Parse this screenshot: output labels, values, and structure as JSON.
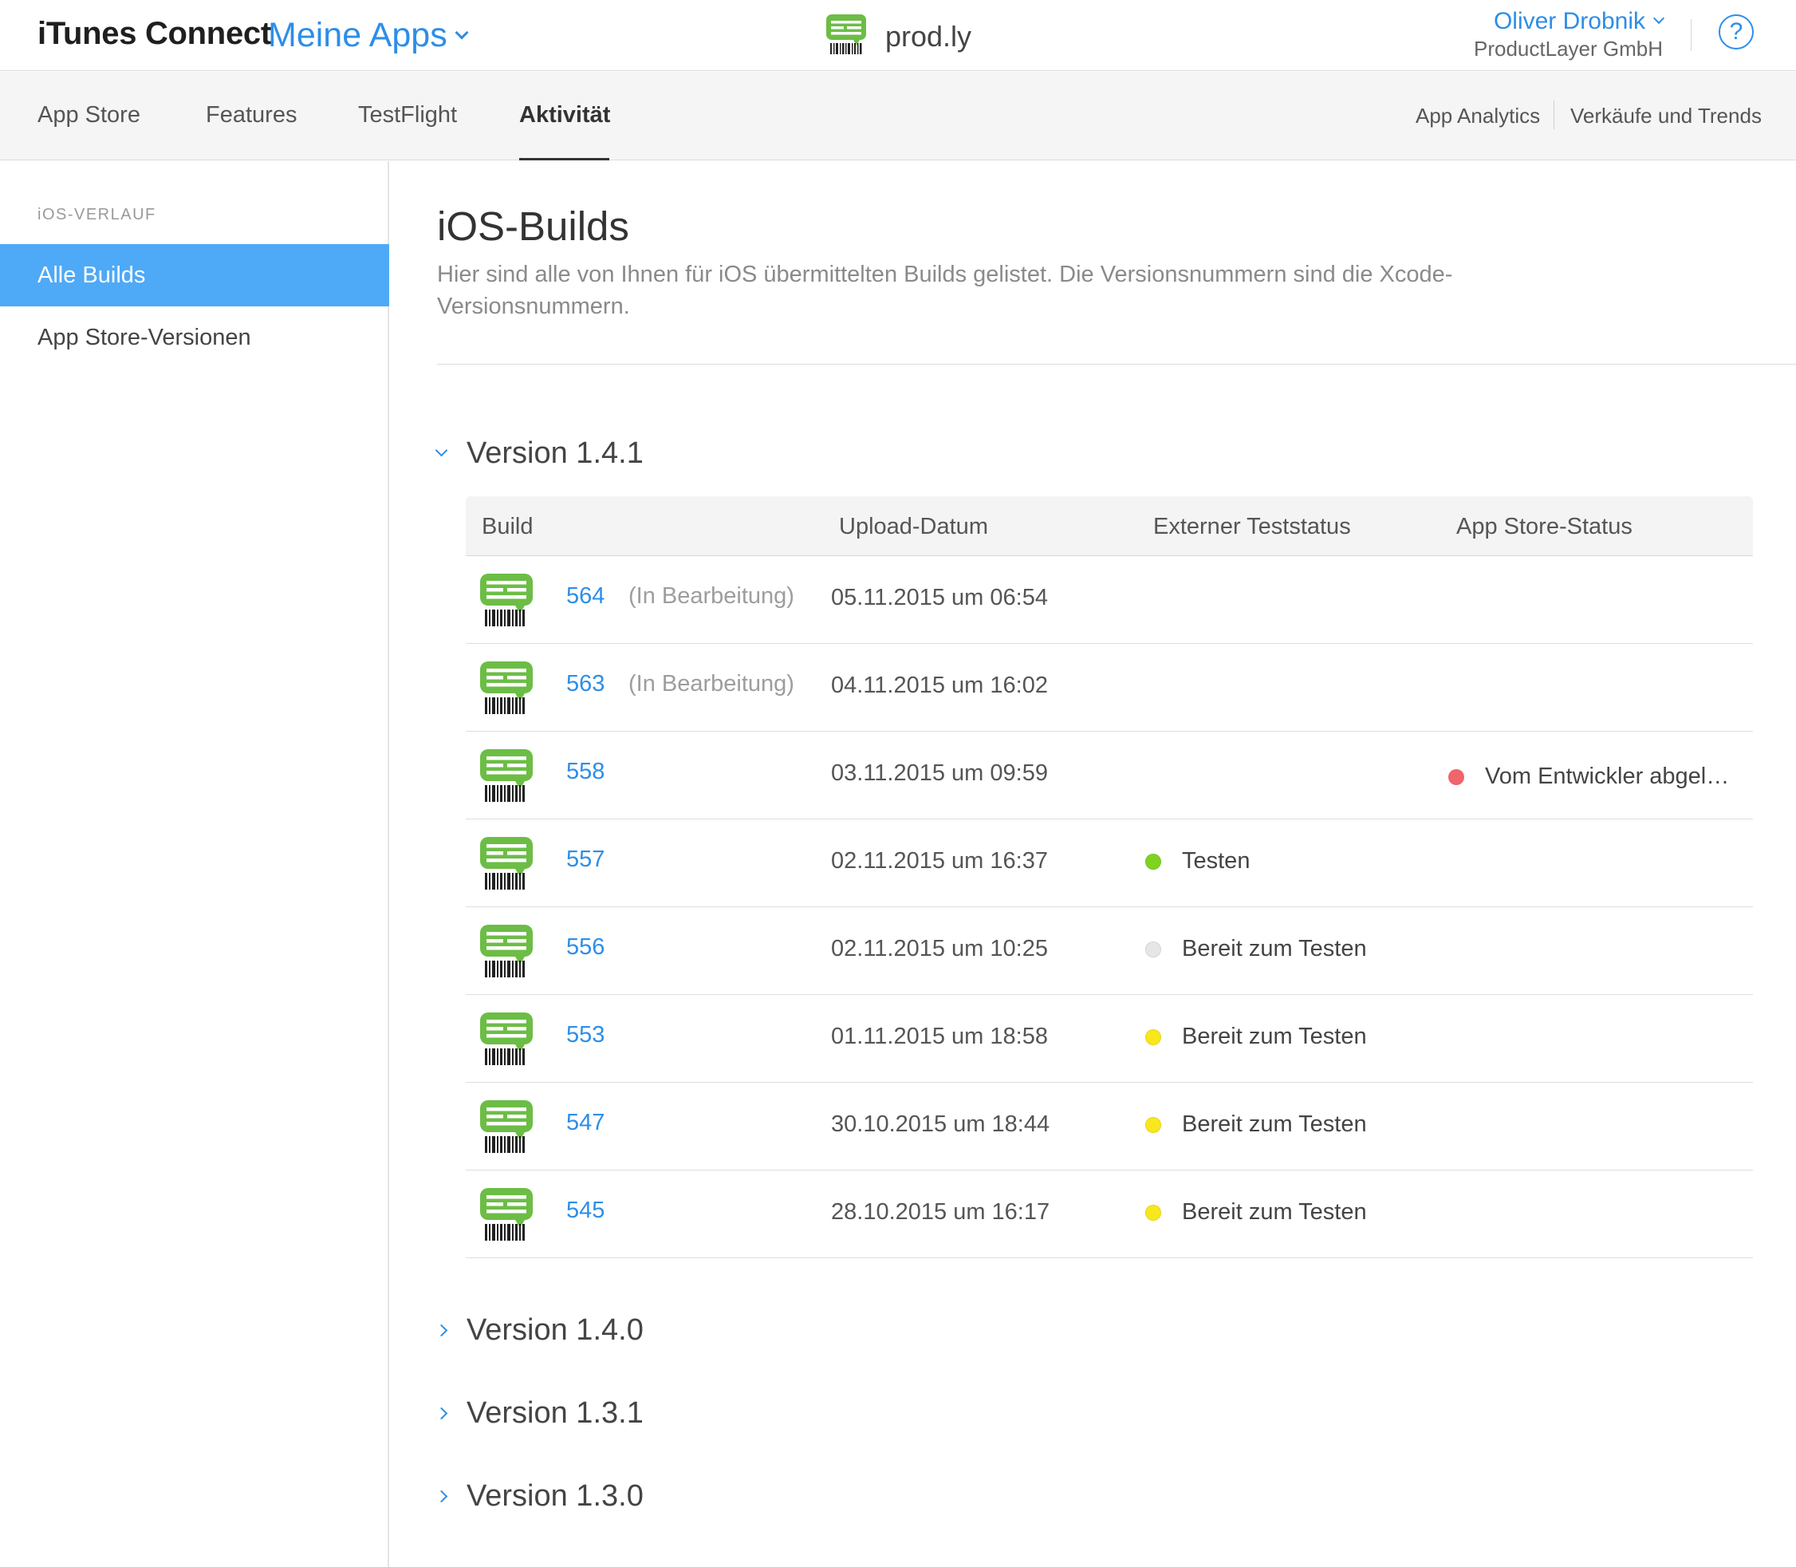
{
  "header": {
    "brand": "iTunes Connect",
    "my_apps": "Meine Apps",
    "app_name": "prod.ly",
    "user_name": "Oliver Drobnik",
    "org_name": "ProductLayer GmbH",
    "help": "?"
  },
  "subnav": {
    "tabs": [
      {
        "label": "App Store"
      },
      {
        "label": "Features"
      },
      {
        "label": "TestFlight"
      },
      {
        "label": "Aktivität"
      }
    ],
    "right_links": [
      {
        "label": "App Analytics"
      },
      {
        "label": "Verkäufe und Trends"
      }
    ]
  },
  "sidebar": {
    "heading": "iOS-VERLAUF",
    "items": [
      {
        "label": "Alle Builds"
      },
      {
        "label": "App Store-Versionen"
      }
    ]
  },
  "main": {
    "title": "iOS-Builds",
    "description": "Hier sind alle von Ihnen für iOS übermittelten Builds gelistet. Die Versionsnummern sind die Xcode-Versionsnummern.",
    "versions": [
      {
        "label": "Version 1.4.1"
      },
      {
        "label": "Version 1.4.0"
      },
      {
        "label": "Version 1.3.1"
      },
      {
        "label": "Version 1.3.0"
      }
    ],
    "table": {
      "columns": [
        "Build",
        "Upload-Datum",
        "Externer Teststatus",
        "App Store-Status"
      ],
      "rows": [
        {
          "build": "564",
          "note": "(In Bearbeitung)",
          "date": "05.11.2015 um 06:54",
          "ext_status": "",
          "ext_color": "",
          "aps_status": "",
          "aps_color": ""
        },
        {
          "build": "563",
          "note": "(In Bearbeitung)",
          "date": "04.11.2015 um 16:02",
          "ext_status": "",
          "ext_color": "",
          "aps_status": "",
          "aps_color": ""
        },
        {
          "build": "558",
          "note": "",
          "date": "03.11.2015 um 09:59",
          "ext_status": "",
          "ext_color": "",
          "aps_status": "Vom Entwickler abgel…",
          "aps_color": "#f0646b"
        },
        {
          "build": "557",
          "note": "",
          "date": "02.11.2015 um 16:37",
          "ext_status": "Testen",
          "ext_color": "#7ed321",
          "aps_status": "",
          "aps_color": ""
        },
        {
          "build": "556",
          "note": "",
          "date": "02.11.2015 um 10:25",
          "ext_status": "Bereit zum Testen",
          "ext_color": "#e6e6e6",
          "aps_status": "",
          "aps_color": ""
        },
        {
          "build": "553",
          "note": "",
          "date": "01.11.2015 um 18:58",
          "ext_status": "Bereit zum Testen",
          "ext_color": "#f8e71c",
          "aps_status": "",
          "aps_color": ""
        },
        {
          "build": "547",
          "note": "",
          "date": "30.10.2015 um 18:44",
          "ext_status": "Bereit zum Testen",
          "ext_color": "#f8e71c",
          "aps_status": "",
          "aps_color": ""
        },
        {
          "build": "545",
          "note": "",
          "date": "28.10.2015 um 16:17",
          "ext_status": "Bereit zum Testen",
          "ext_color": "#f8e71c",
          "aps_status": "",
          "aps_color": ""
        }
      ]
    }
  },
  "colors": {
    "accent": "#2c8ee8",
    "sidebar_active": "#4ea9f7",
    "app_icon_green": "#6cbd45"
  }
}
